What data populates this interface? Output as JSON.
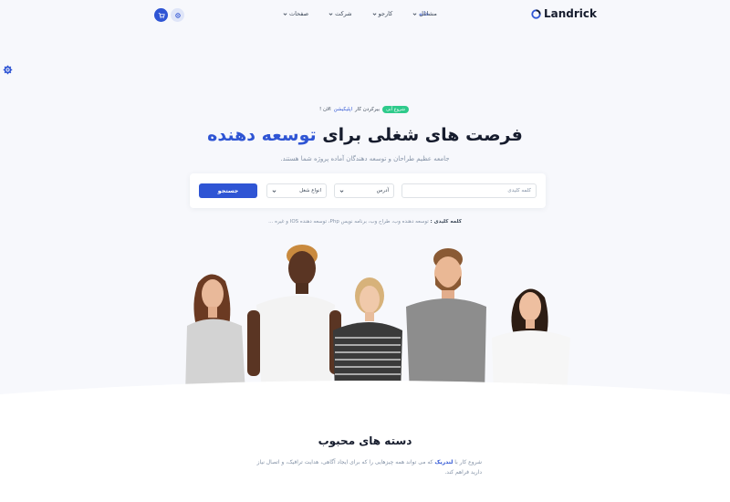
{
  "header": {
    "logo_text": "Landrick",
    "nav": {
      "home": "خانه",
      "items": [
        "مشاغل",
        "کارجو",
        "شرکت",
        "صفحات"
      ]
    },
    "icons": {
      "cart": "cart-icon",
      "settings": "gear-icon",
      "side": "gear-icon"
    }
  },
  "hero": {
    "badge": "شروع آنی",
    "tagline_part1": "بیرکردن کار",
    "tagline_link": "اپلیکیشن",
    "tagline_part2": "الان !",
    "title_main": "فرصت های شغلی برای",
    "title_accent": "توسعه دهنده",
    "subtitle": "جامعه عظیم طراحان و توسعه دهندگان آماده پروژه شما هستند.",
    "search": {
      "keyword_placeholder": "کلمه کلیدی",
      "address_label": "آدرس",
      "job_type_label": "انواع شغل",
      "button_label": "جستجو"
    },
    "keywords_label": "کلمه کلیدی :",
    "keywords_text": "توسعه دهنده وب، طراح وب، برنامه نویس Php، توسعه دهنده IOS و غیره ..."
  },
  "section": {
    "title": "دسته های محبوب",
    "text_part1": "شروع کار با",
    "brand": "لندریک",
    "text_part2": "که می تواند همه چیزهایی را که برای ایجاد آگاهی، هدایت ترافیک، و اتصال نیاز دارید فراهم کند."
  },
  "colors": {
    "primary": "#2f55d4",
    "success": "#2eca8b",
    "dark": "#161c2d",
    "muted": "#8492a6"
  }
}
